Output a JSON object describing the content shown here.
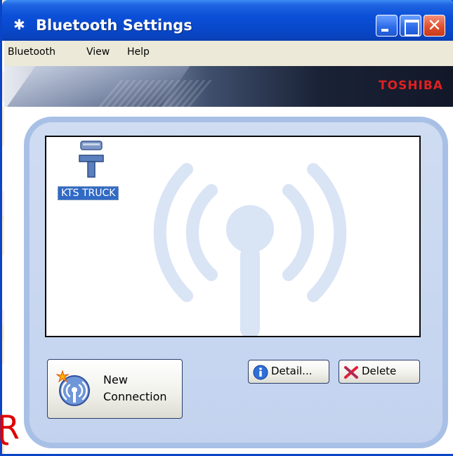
{
  "window": {
    "title": "Bluetooth Settings",
    "title_icon": "bluetooth-icon"
  },
  "menubar": {
    "items": [
      "Bluetooth",
      "View",
      "Help"
    ]
  },
  "banner": {
    "brand": "TOSHIBA"
  },
  "device_list": {
    "devices": [
      {
        "label": "KTS TRUCK",
        "icon": "serial-port-device-icon",
        "selected": true
      }
    ]
  },
  "buttons": {
    "new_connection": {
      "label_line1": "New",
      "label_line2": "Connection",
      "icon": "bluetooth-signal-icon"
    },
    "detail": {
      "label": "Detail...",
      "icon": "info-icon"
    },
    "delete": {
      "label": "Delete",
      "icon": "delete-x-icon"
    }
  },
  "colors": {
    "titlebar": "#0846c6",
    "selection": "#316ac5",
    "brand": "#e02020",
    "panel": "#c3d3ef"
  }
}
